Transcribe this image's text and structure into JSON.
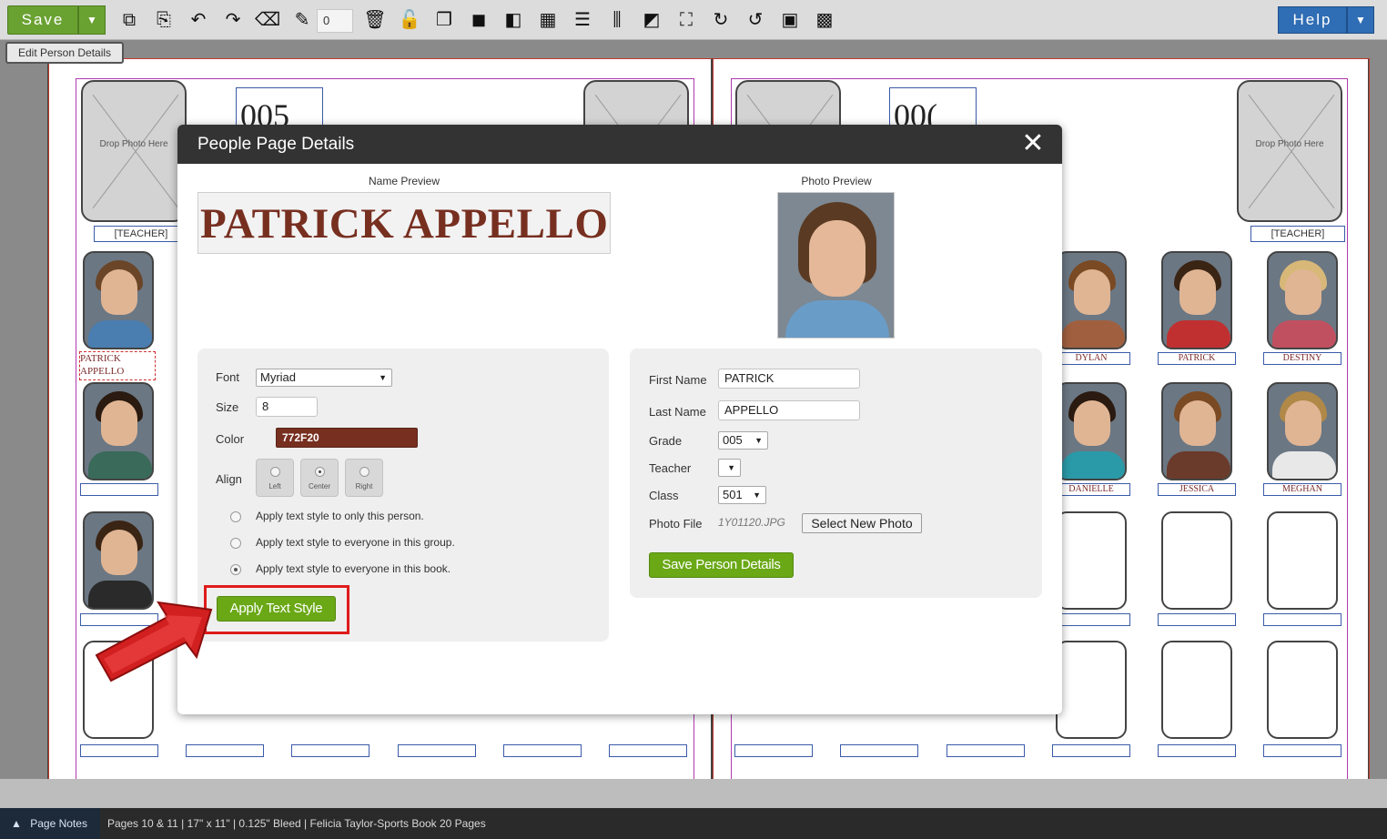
{
  "toolbar": {
    "save_label": "Save",
    "dropdown_arrow": "▼",
    "counter_value": "0",
    "help_label": "Help",
    "tools": [
      "copy-icon",
      "paste-icon",
      "undo-icon",
      "redo-icon",
      "eraser-icon",
      "edit-pen-icon",
      "trash-icon",
      "unlock-icon",
      "layers-icon",
      "bring-front-icon",
      "send-back-icon",
      "group-icon",
      "align-left-icon",
      "distribute-icon",
      "crop-icon",
      "fit-icon",
      "rotate-right-icon",
      "rotate-left-icon",
      "frame-icon",
      "grid-icon"
    ]
  },
  "edit_tab": {
    "label": "Edit Person Details"
  },
  "canvas": {
    "drop_photo_text": "Drop Photo Here",
    "teacher_label": "[TEACHER]",
    "left_name_top": "PATRICK",
    "left_name_bottom": "APPELLO",
    "header_number_left": "005",
    "header_number_right": "00(",
    "names": {
      "dylan": "DYLAN",
      "patrick": "PATRICK",
      "destiny": "DESTINY",
      "danielle": "DANIELLE",
      "jessica": "JESSICA",
      "meghan": "MEGHAN"
    }
  },
  "modal": {
    "title": "People Page Details",
    "close_glyph": "✕",
    "name_preview_label": "Name Preview",
    "name_preview_text": "PATRICK APPELLO",
    "photo_preview_label": "Photo Preview",
    "text_style": {
      "font_label": "Font",
      "font_value": "Myriad",
      "size_label": "Size",
      "size_value": "8",
      "color_label": "Color",
      "color_value": "772F20",
      "align_label": "Align",
      "align_left": "Left",
      "align_center": "Center",
      "align_right": "Right",
      "options": [
        "Apply text style to only this person.",
        "Apply text style to everyone in this group.",
        "Apply text style to everyone in this book."
      ],
      "apply_button": "Apply Text Style"
    },
    "person": {
      "first_name_label": "First Name",
      "first_name_value": "PATRICK",
      "last_name_label": "Last Name",
      "last_name_value": "APPELLO",
      "grade_label": "Grade",
      "grade_value": "005",
      "teacher_label": "Teacher",
      "teacher_value": "",
      "class_label": "Class",
      "class_value": "501",
      "photo_file_label": "Photo File",
      "photo_file_value": "1Y01120.JPG",
      "select_photo_button": "Select New Photo",
      "save_button": "Save Person Details"
    }
  },
  "footer": {
    "page_notes": "Page Notes",
    "info": "Pages 10 & 11 | 17\" x 11\" | 0.125\" Bleed | Felicia Taylor-Sports Book 20 Pages"
  },
  "colors": {
    "accent_green": "#6aa816",
    "help_blue": "#2f6db4",
    "name_color": "#772F20",
    "highlight_red": "#e01b1b"
  }
}
